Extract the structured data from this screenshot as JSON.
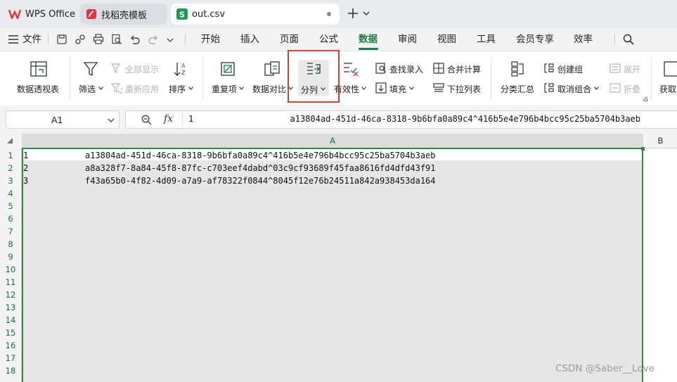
{
  "tabs": [
    {
      "label": "WPS Office",
      "icon": "wps-logo-icon"
    },
    {
      "label": "找稻壳模板",
      "icon": "docer-icon"
    },
    {
      "label": "out.csv",
      "icon": "spreadsheet-s-icon"
    }
  ],
  "menu": {
    "file": "文件",
    "items": [
      "开始",
      "插入",
      "页面",
      "公式",
      "数据",
      "审阅",
      "视图",
      "工具",
      "会员专享",
      "效率"
    ],
    "active": "数据"
  },
  "ribbon": {
    "pivot": "数据透视表",
    "filter": "筛选",
    "show_all": "全部显示",
    "reapply": "重新应用",
    "sort": "排序",
    "duplicates": "重复项",
    "compare": "数据对比",
    "split": "分列",
    "validity": "有效性",
    "find_entry": "查找录入",
    "fill": "填充",
    "consolidate": "合并计算",
    "dropdown_list": "下拉列表",
    "subtotal": "分类汇总",
    "create_group": "创建组",
    "ungroup": "取消组合",
    "expand": "展开",
    "collapse": "折叠",
    "get": "获取"
  },
  "formula_bar": {
    "cell_ref": "A1",
    "fx": "fx",
    "value": "1                   a13804ad-451d-46ca-8318-9b6bfa0a89c4^416b5e4e796b4bcc95c25ba5704b3aeb"
  },
  "columns": [
    "A",
    "B"
  ],
  "rows": [
    {
      "num": "1",
      "a": "1",
      "text": "a13804ad-451d-46ca-8318-9b6bfa0a89c4^416b5e4e796b4bcc95c25ba5704b3aeb"
    },
    {
      "num": "2",
      "a": "2",
      "text": "a8a328f7-8a84-45f8-87fc-c703eef4dabd^03c9cf93689f45faa8616fd4dfd43f91"
    },
    {
      "num": "3",
      "a": "3",
      "text": "f43a65b0-4f82-4d09-a7a9-af78322f0844^8045f12e76b24511a842a938453da164"
    }
  ],
  "empty_rows": [
    "4",
    "5",
    "6",
    "7",
    "8",
    "9",
    "10",
    "11",
    "12",
    "13",
    "14",
    "15",
    "16",
    "17",
    "18"
  ],
  "watermark": "CSDN @Saber__Love",
  "colors": {
    "accent": "#1e7b45",
    "highlight_box": "#e03b3b",
    "selection_fill": "#e6e6e6",
    "selection_border": "#2f8a3c"
  }
}
